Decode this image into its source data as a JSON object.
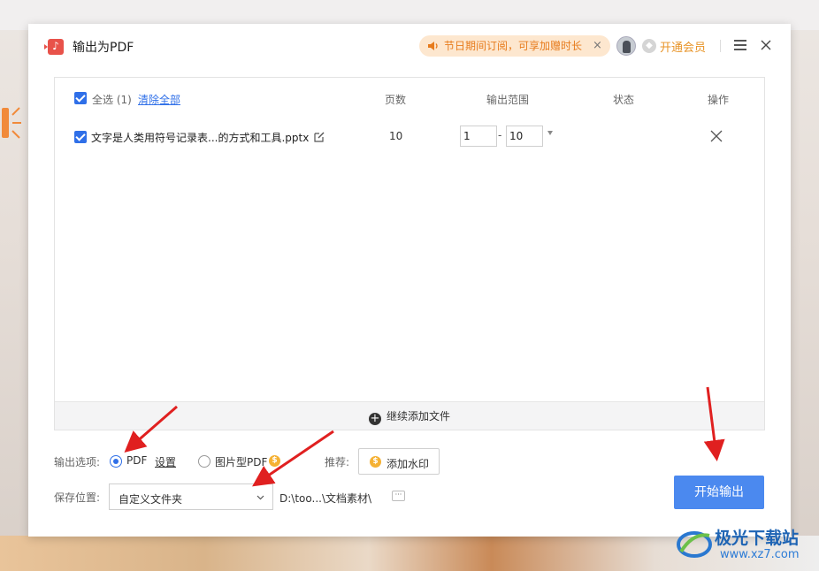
{
  "dialog": {
    "title": "输出为PDF",
    "promo_text": "节日期间订阅，可享加赠时长",
    "promo_close": "×",
    "vip_label": "开通会员"
  },
  "file_list": {
    "select_all_label": "全选 (1)",
    "clear_all_label": "清除全部",
    "columns": {
      "pages": "页数",
      "range": "输出范围",
      "status": "状态",
      "action": "操作"
    },
    "rows": [
      {
        "name": "文字是人类用符号记录表...的方式和工具.pptx",
        "pages": "10",
        "range_from": "1",
        "range_to": "10",
        "status": "",
        "checked": true
      }
    ],
    "add_more_label": "继续添加文件"
  },
  "output_options": {
    "label": "输出选项:",
    "pdf_option": "PDF",
    "settings_link": "设置",
    "image_pdf_option": "图片型PDF",
    "selected": "PDF",
    "recommend_label": "推荐:",
    "watermark_button": "添加水印"
  },
  "save_location": {
    "label": "保存位置:",
    "selected": "自定义文件夹",
    "path": "D:\\too...\\文档素材\\",
    "more_button": "···"
  },
  "start_button": "开始输出",
  "site_watermark": {
    "name": "极光下载站",
    "url": "www.xz7.com"
  },
  "colors": {
    "accent": "#4b89ef",
    "checkbox": "#2f6fe8",
    "promo_bg": "#fde7cf",
    "promo_text": "#e77b1c",
    "vip": "#e89428",
    "annotation_arrow": "#e02020"
  }
}
